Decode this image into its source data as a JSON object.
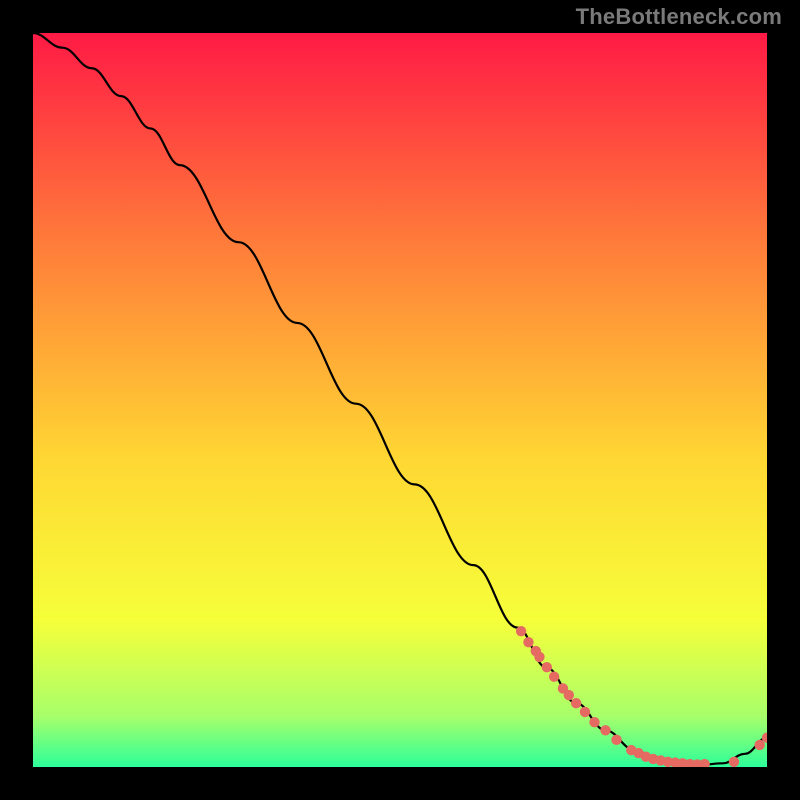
{
  "watermark": "TheBottleneck.com",
  "colors": {
    "gradient_top": "#ff1a45",
    "gradient_mid1": "#ff7a3a",
    "gradient_mid2": "#ffd733",
    "gradient_mid3": "#f6ff3a",
    "gradient_bot1": "#a8ff6a",
    "gradient_bot2": "#2dff9a",
    "curve": "#000000",
    "dot": "#e46a62",
    "black": "#000000"
  },
  "chart_data": {
    "type": "line",
    "title": "",
    "xlabel": "",
    "ylabel": "",
    "xlim": [
      0,
      100
    ],
    "ylim": [
      0,
      100
    ],
    "curve": {
      "x": [
        0,
        4,
        8,
        12,
        16,
        20,
        28,
        36,
        44,
        52,
        60,
        66,
        70,
        74,
        78,
        82,
        85,
        88,
        91,
        94,
        97,
        100
      ],
      "y": [
        100,
        98,
        95.2,
        91.4,
        87,
        82,
        71.5,
        60.5,
        49.5,
        38.5,
        27.5,
        19,
        13.5,
        8.7,
        5.0,
        2.3,
        1.1,
        0.5,
        0.3,
        0.5,
        1.8,
        4.0
      ]
    },
    "dots": [
      {
        "x": 66.5,
        "y": 18.5
      },
      {
        "x": 67.5,
        "y": 17.0
      },
      {
        "x": 68.5,
        "y": 15.8
      },
      {
        "x": 69.0,
        "y": 15.0
      },
      {
        "x": 70.0,
        "y": 13.6
      },
      {
        "x": 71.0,
        "y": 12.3
      },
      {
        "x": 72.2,
        "y": 10.7
      },
      {
        "x": 73.0,
        "y": 9.8
      },
      {
        "x": 74.0,
        "y": 8.7
      },
      {
        "x": 75.2,
        "y": 7.5
      },
      {
        "x": 76.5,
        "y": 6.1
      },
      {
        "x": 78.0,
        "y": 5.0
      },
      {
        "x": 79.5,
        "y": 3.7
      },
      {
        "x": 81.5,
        "y": 2.3
      },
      {
        "x": 82.5,
        "y": 1.9
      },
      {
        "x": 83.5,
        "y": 1.4
      },
      {
        "x": 84.5,
        "y": 1.1
      },
      {
        "x": 85.5,
        "y": 0.9
      },
      {
        "x": 86.5,
        "y": 0.7
      },
      {
        "x": 87.5,
        "y": 0.6
      },
      {
        "x": 88.5,
        "y": 0.5
      },
      {
        "x": 89.5,
        "y": 0.4
      },
      {
        "x": 90.5,
        "y": 0.35
      },
      {
        "x": 91.5,
        "y": 0.4
      },
      {
        "x": 95.5,
        "y": 0.7
      },
      {
        "x": 99.0,
        "y": 3.0
      },
      {
        "x": 100.0,
        "y": 4.0
      }
    ],
    "annotations": []
  }
}
